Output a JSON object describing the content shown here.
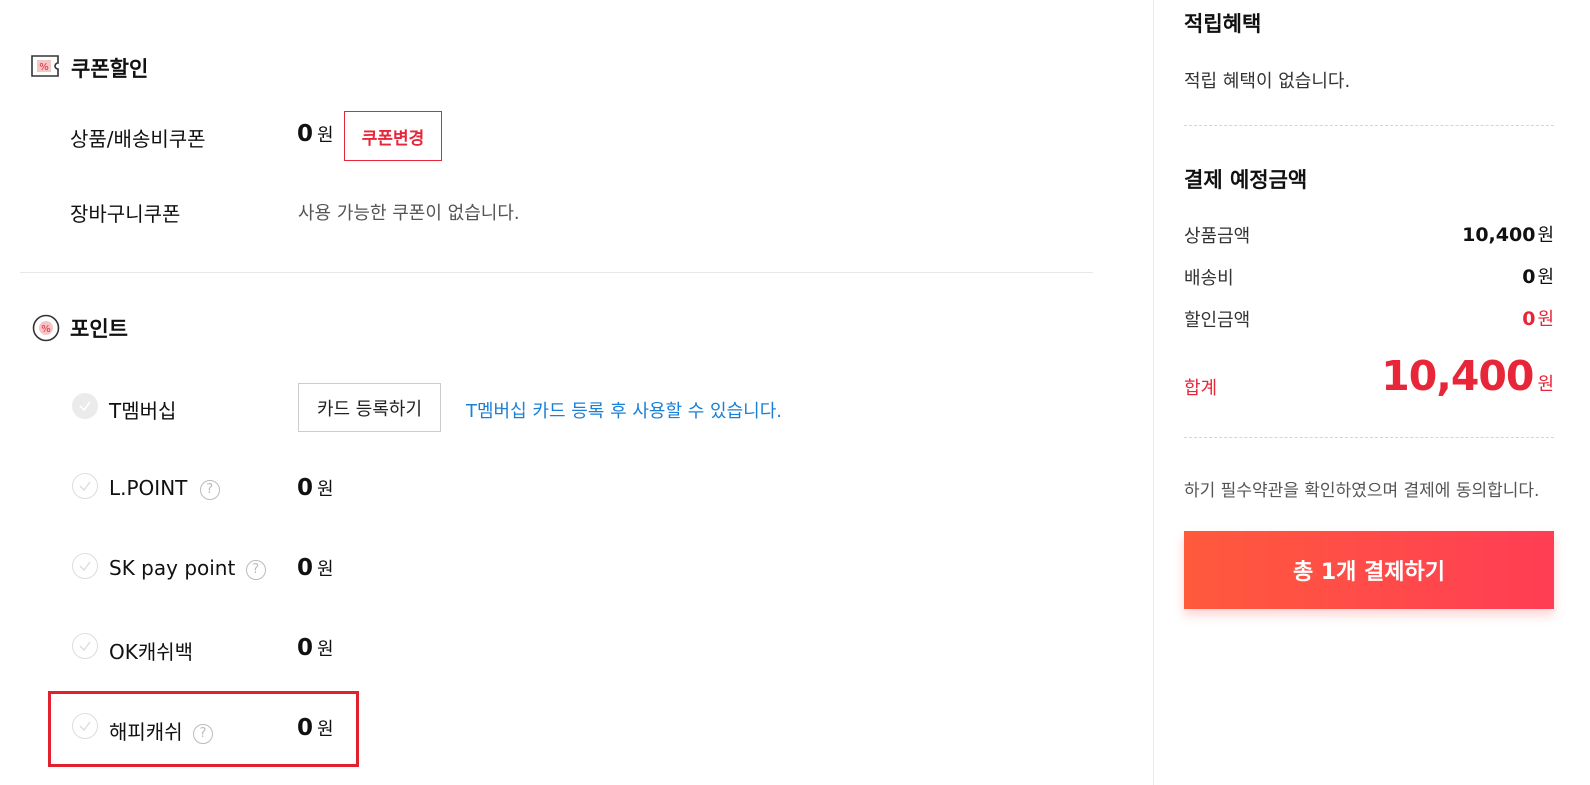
{
  "coupon": {
    "title": "쿠폰할인",
    "rows": [
      {
        "label": "상품/배송비쿠폰",
        "amount": "0",
        "unit": "원",
        "button": "쿠폰변경"
      },
      {
        "label": "장바구니쿠폰",
        "message": "사용 가능한 쿠폰이 없습니다."
      }
    ]
  },
  "points": {
    "title": "포인트",
    "tmembership": {
      "label": "T멤버십",
      "button": "카드 등록하기",
      "notice": "T멤버십 카드 등록 후 사용할 수 있습니다."
    },
    "items": [
      {
        "label": "L.POINT",
        "amount": "0",
        "unit": "원"
      },
      {
        "label": "SK pay point",
        "amount": "0",
        "unit": "원"
      },
      {
        "label": "OK캐쉬백",
        "amount": "0",
        "unit": "원"
      },
      {
        "label": "해피캐쉬",
        "amount": "0",
        "unit": "원"
      }
    ]
  },
  "sidebar": {
    "reward_title": "적립혜택",
    "reward_message": "적립 혜택이 없습니다.",
    "payment_title": "결제 예정금액",
    "product_amount_label": "상품금액",
    "product_amount": "10,400",
    "shipping_label": "배송비",
    "shipping_amount": "0",
    "discount_label": "할인금액",
    "discount_amount": "0",
    "unit": "원",
    "total_label": "합계",
    "total_amount": "10,400",
    "agreement": "하기 필수약관을 확인하였으며 결제에 동의합니다.",
    "pay_button": "총 1개 결제하기"
  },
  "colors": {
    "accent_red": "#e8263a",
    "link_blue": "#1a7fd6",
    "highlight_box": "#e3202e"
  }
}
